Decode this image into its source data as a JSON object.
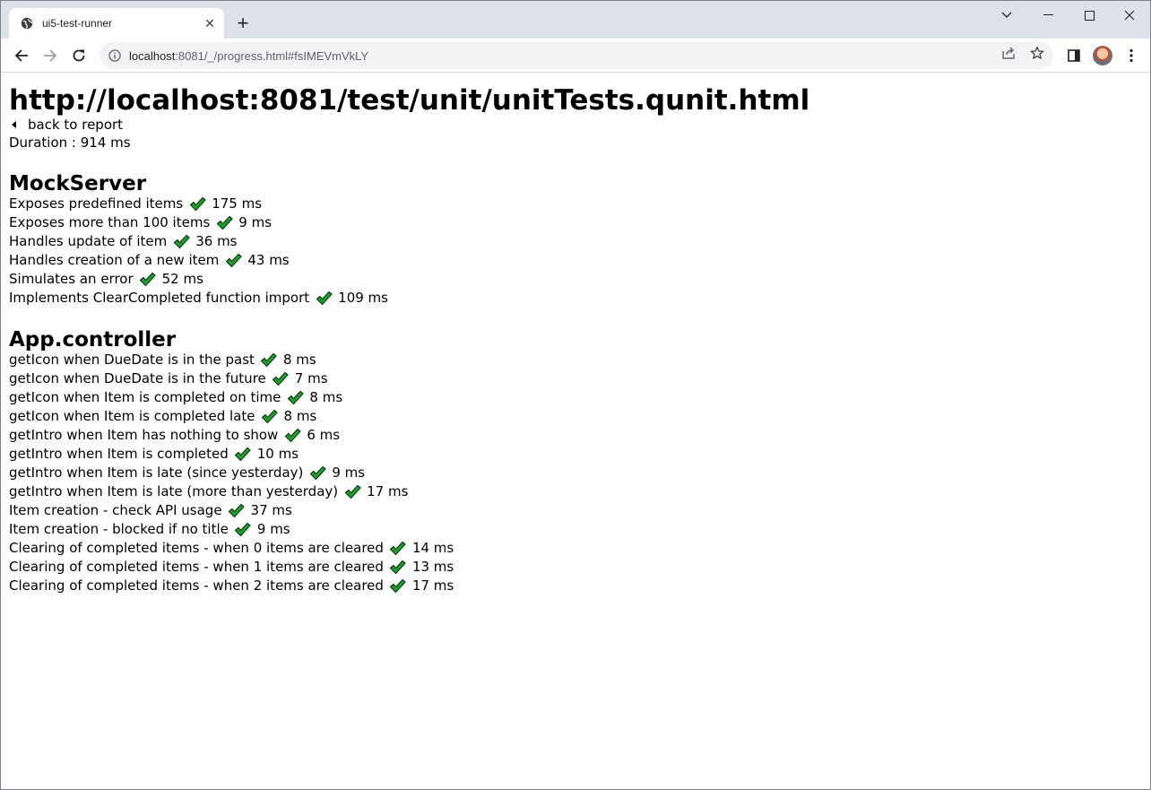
{
  "browser": {
    "tab_title": "ui5-test-runner",
    "tab_close": "✕",
    "new_tab": "+",
    "url_host": "localhost",
    "url_rest": ":8081/_/progress.html#fsIMEVmVkLY"
  },
  "page": {
    "title": "http://localhost:8081/test/unit/unitTests.qunit.html",
    "back_link": "back to report",
    "duration": "Duration : 914 ms"
  },
  "modules": [
    {
      "name": "MockServer",
      "tests": [
        {
          "label": "Exposes predefined items",
          "time": "175 ms",
          "status": "passed"
        },
        {
          "label": "Exposes more than 100 items",
          "time": "9 ms",
          "status": "passed"
        },
        {
          "label": "Handles update of item",
          "time": "36 ms",
          "status": "passed"
        },
        {
          "label": "Handles creation of a new item",
          "time": "43 ms",
          "status": "passed"
        },
        {
          "label": "Simulates an error",
          "time": "52 ms",
          "status": "passed"
        },
        {
          "label": "Implements ClearCompleted function import",
          "time": "109 ms",
          "status": "passed"
        }
      ]
    },
    {
      "name": "App.controller",
      "tests": [
        {
          "label": "getIcon when DueDate is in the past",
          "time": "8 ms",
          "status": "passed"
        },
        {
          "label": "getIcon when DueDate is in the future",
          "time": "7 ms",
          "status": "passed"
        },
        {
          "label": "getIcon when Item is completed on time",
          "time": "8 ms",
          "status": "passed"
        },
        {
          "label": "getIcon when Item is completed late",
          "time": "8 ms",
          "status": "passed"
        },
        {
          "label": "getIntro when Item has nothing to show",
          "time": "6 ms",
          "status": "passed"
        },
        {
          "label": "getIntro when Item is completed",
          "time": "10 ms",
          "status": "passed"
        },
        {
          "label": "getIntro when Item is late (since yesterday)",
          "time": "9 ms",
          "status": "passed"
        },
        {
          "label": "getIntro when Item is late (more than yesterday)",
          "time": "17 ms",
          "status": "passed"
        },
        {
          "label": "Item creation - check API usage",
          "time": "37 ms",
          "status": "passed"
        },
        {
          "label": "Item creation - blocked if no title",
          "time": "9 ms",
          "status": "passed"
        },
        {
          "label": "Clearing of completed items - when 0 items are cleared",
          "time": "14 ms",
          "status": "passed"
        },
        {
          "label": "Clearing of completed items - when 1 items are cleared",
          "time": "13 ms",
          "status": "passed"
        },
        {
          "label": "Clearing of completed items - when 2 items are cleared",
          "time": "17 ms",
          "status": "passed"
        }
      ]
    }
  ],
  "colors": {
    "check_fill": "#1f9e2b",
    "check_stroke": "#0a3d10"
  },
  "icons": {
    "tab": "globe-icon",
    "back": "arrow-left-icon",
    "forward": "arrow-right-icon",
    "reload": "reload-icon",
    "info": "info-icon",
    "share": "share-icon",
    "bookmark": "star-icon",
    "side_panel": "side-panel-icon",
    "menu": "kebab-menu-icon",
    "test_status": "checkmark-icon"
  }
}
